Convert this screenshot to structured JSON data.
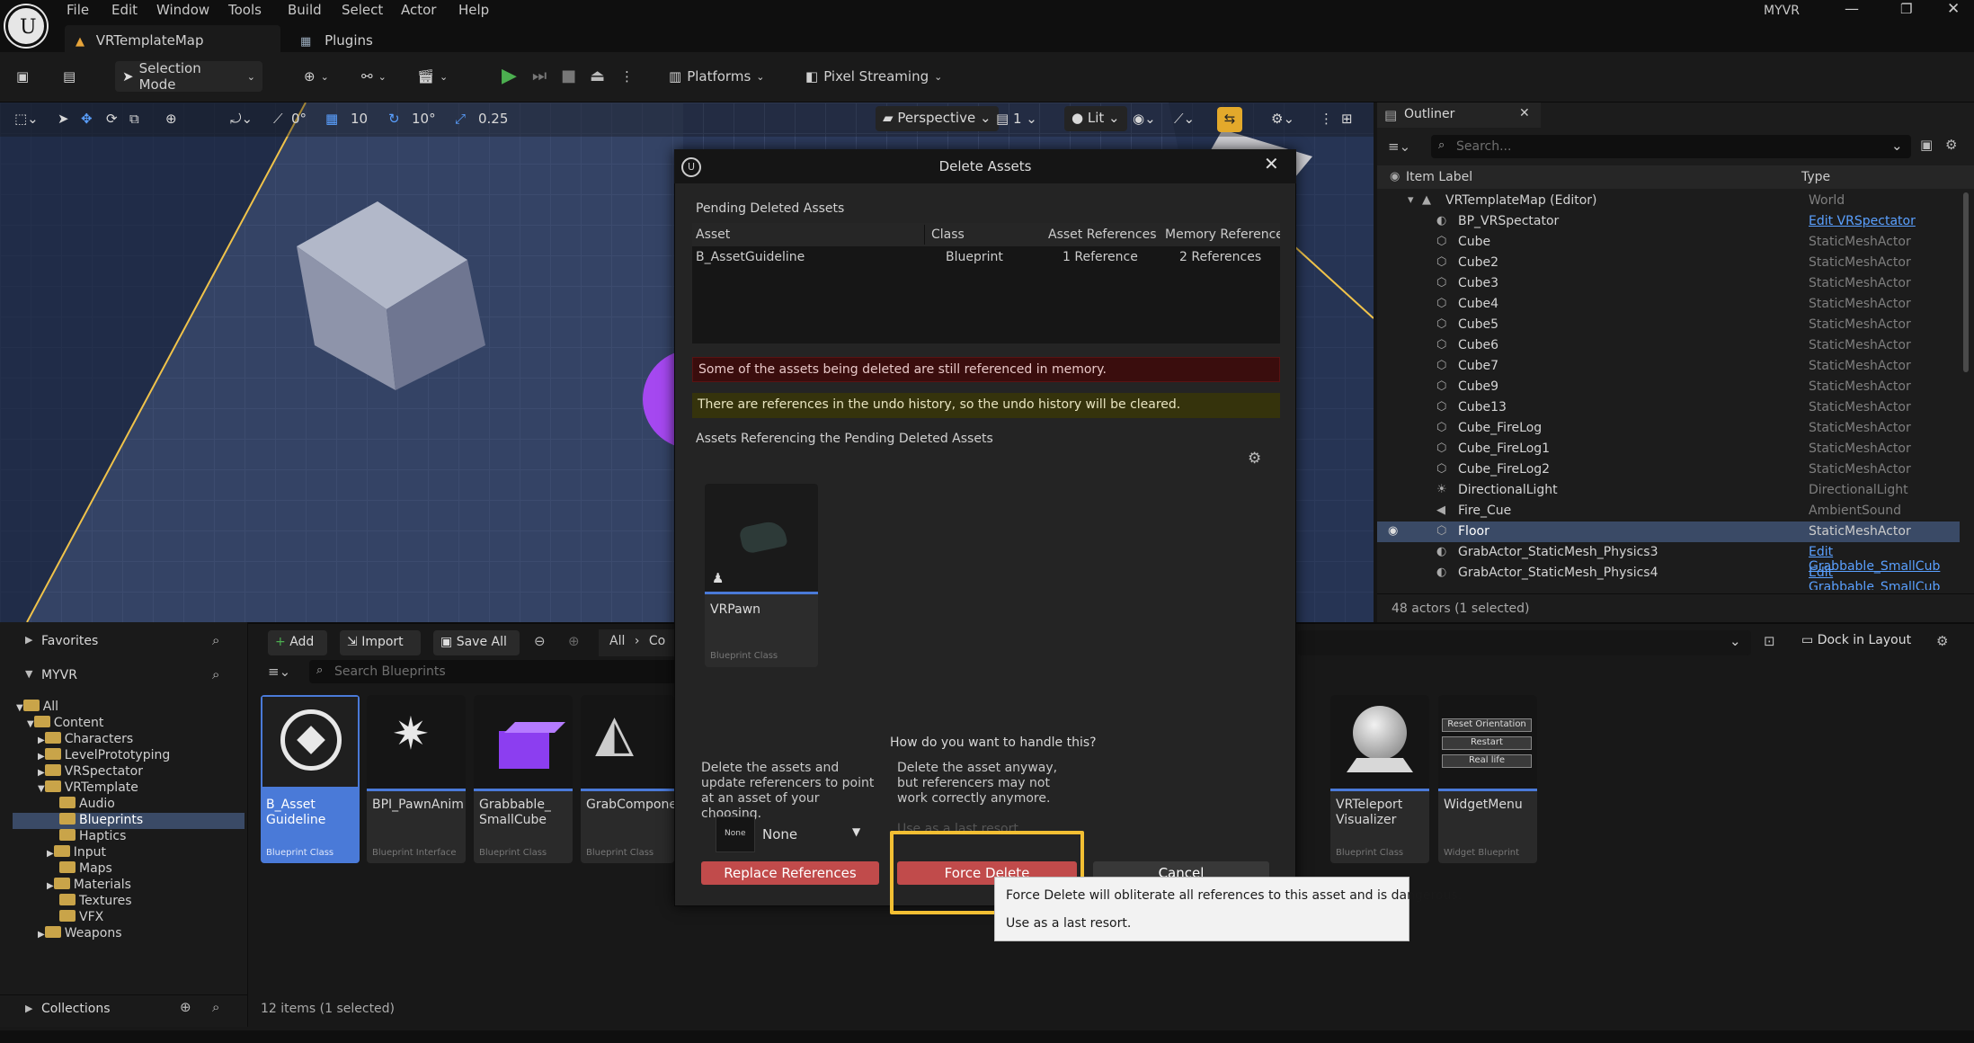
{
  "menu": [
    "File",
    "Edit",
    "Window",
    "Tools",
    "Build",
    "Select",
    "Actor",
    "Help"
  ],
  "project_name": "MYVR",
  "tabs": {
    "level": "VRTemplateMap",
    "plugins": "Plugins"
  },
  "toolbar": {
    "selection_mode": "Selection Mode",
    "platforms": "Platforms",
    "pixel_streaming": "Pixel Streaming"
  },
  "viewport": {
    "grid_angle": "0°",
    "grid_size": "10",
    "rotation_snap": "10°",
    "scale_snap": "0.25",
    "perspective": "Perspective",
    "camera_speed": "1",
    "view_mode": "Lit"
  },
  "outliner": {
    "title": "Outliner",
    "search_placeholder": "Search...",
    "col_label": "Item Label",
    "col_type": "Type",
    "rows": [
      {
        "label": "VRTemplateMap (Editor)",
        "type": "World",
        "link": false
      },
      {
        "label": "BP_VRSpectator",
        "type": "Edit VRSpectator",
        "link": true
      },
      {
        "label": "Cube",
        "type": "StaticMeshActor",
        "link": false
      },
      {
        "label": "Cube2",
        "type": "StaticMeshActor",
        "link": false
      },
      {
        "label": "Cube3",
        "type": "StaticMeshActor",
        "link": false
      },
      {
        "label": "Cube4",
        "type": "StaticMeshActor",
        "link": false
      },
      {
        "label": "Cube5",
        "type": "StaticMeshActor",
        "link": false
      },
      {
        "label": "Cube6",
        "type": "StaticMeshActor",
        "link": false
      },
      {
        "label": "Cube7",
        "type": "StaticMeshActor",
        "link": false
      },
      {
        "label": "Cube9",
        "type": "StaticMeshActor",
        "link": false
      },
      {
        "label": "Cube13",
        "type": "StaticMeshActor",
        "link": false
      },
      {
        "label": "Cube_FireLog",
        "type": "StaticMeshActor",
        "link": false
      },
      {
        "label": "Cube_FireLog1",
        "type": "StaticMeshActor",
        "link": false
      },
      {
        "label": "Cube_FireLog2",
        "type": "StaticMeshActor",
        "link": false
      },
      {
        "label": "DirectionalLight",
        "type": "DirectionalLight",
        "link": false
      },
      {
        "label": "Fire_Cue",
        "type": "AmbientSound",
        "link": false
      },
      {
        "label": "Floor",
        "type": "StaticMeshActor",
        "link": false
      },
      {
        "label": "GrabActor_StaticMesh_Physics3",
        "type": "Edit Grabbable_SmallCub",
        "link": true
      },
      {
        "label": "GrabActor_StaticMesh_Physics4",
        "type": "Edit Grabbable_SmallCub",
        "link": true
      }
    ],
    "status": "48 actors (1 selected)"
  },
  "content_browser": {
    "favorites": "Favorites",
    "project": "MYVR",
    "add": "Add",
    "import": "Import",
    "save_all": "Save All",
    "breadcrumb_all": "All",
    "breadcrumb_next": "Co",
    "search_placeholder": "Search Blueprints",
    "dock_in_layout": "Dock in Layout",
    "tree": [
      {
        "label": "All",
        "depth": 0
      },
      {
        "label": "Content",
        "depth": 1
      },
      {
        "label": "Characters",
        "depth": 2
      },
      {
        "label": "LevelPrototyping",
        "depth": 2
      },
      {
        "label": "VRSpectator",
        "depth": 2
      },
      {
        "label": "VRTemplate",
        "depth": 2
      },
      {
        "label": "Audio",
        "depth": 3
      },
      {
        "label": "Blueprints",
        "depth": 3
      },
      {
        "label": "Haptics",
        "depth": 3
      },
      {
        "label": "Input",
        "depth": 3
      },
      {
        "label": "Maps",
        "depth": 3
      },
      {
        "label": "Materials",
        "depth": 3
      },
      {
        "label": "Textures",
        "depth": 3
      },
      {
        "label": "VFX",
        "depth": 3
      },
      {
        "label": "Weapons",
        "depth": 2
      }
    ],
    "collections": "Collections",
    "items_count": "12 items (1 selected)",
    "assets": [
      {
        "name": "B_Asset Guideline",
        "kind": "Blueprint Class"
      },
      {
        "name": "BPI_PawnAnim",
        "kind": "Blueprint Interface"
      },
      {
        "name": "Grabbable_ SmallCube",
        "kind": "Blueprint Class"
      },
      {
        "name": "GrabComponent",
        "kind": "Blueprint Class"
      },
      {
        "name": "VRTeleport Visualizer",
        "kind": "Blueprint Class"
      },
      {
        "name": "WidgetMenu",
        "kind": "Widget Blueprint"
      }
    ],
    "widget_menu_buttons": [
      "Reset Orientation",
      "Restart",
      "Real life"
    ]
  },
  "dialog": {
    "title": "Delete Assets",
    "pending_heading": "Pending Deleted Assets",
    "columns": [
      "Asset",
      "Class",
      "Asset References",
      "Memory Reference"
    ],
    "row": {
      "asset": "B_AssetGuideline",
      "class": "Blueprint",
      "refs": "1 Reference",
      "mem": "2 References"
    },
    "error_msg": "Some of the assets being deleted are still referenced in memory.",
    "warning_msg": "There are references in the undo history, so the undo history will be cleared.",
    "referencing_heading": "Assets Referencing the Pending Deleted Assets",
    "ref_asset": {
      "name": "VRPawn",
      "kind": "Blueprint Class"
    },
    "question": "How do you want to handle this?",
    "replace_desc": "Delete the assets and update referencers to point at an asset of your choosing.",
    "force_desc": "Delete the asset anyway, but referencers may not work correctly anymore.",
    "force_desc_hidden": "Use as a last resort.",
    "replace_thumb": "None",
    "replace_value": "None",
    "replace_btn": "Replace References",
    "force_btn": "Force Delete",
    "cancel_btn": "Cancel"
  },
  "tooltip": {
    "line1": "Force Delete will obliterate all references to this asset and is dangerous.",
    "line2": "Use as a last resort."
  },
  "colors": {
    "error_bg": "#3a0d0d",
    "warning_bg": "#35330c",
    "danger": "#c14b4b",
    "highlight": "#f2bf33",
    "accent": "#4a7ad8"
  }
}
